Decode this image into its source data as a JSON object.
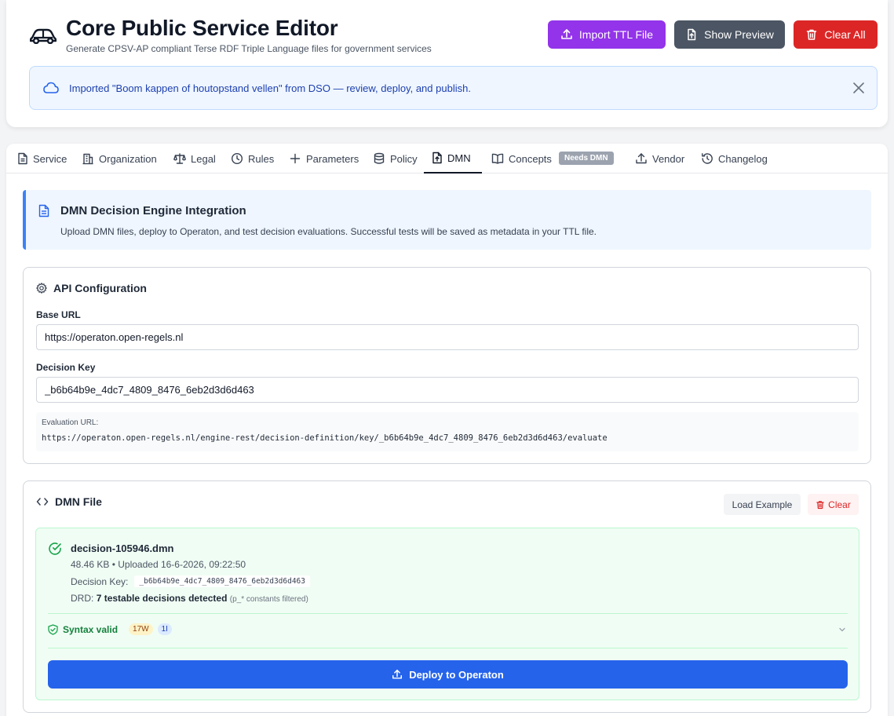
{
  "header": {
    "title": "Core Public Service Editor",
    "subtitle": "Generate CPSV-AP compliant Terse RDF Triple Language files for government services",
    "buttons": {
      "import": "Import TTL File",
      "preview": "Show Preview",
      "clear_all": "Clear All"
    },
    "colors": {
      "import": "#9333ea",
      "preview": "#4b5563",
      "clear_all": "#dc2626"
    }
  },
  "notice": {
    "text": "Imported \"Boom kappen of houtopstand vellen\" from DSO — review, deploy, and publish."
  },
  "tabs": [
    {
      "label": "Service",
      "icon": "document-icon"
    },
    {
      "label": "Organization",
      "icon": "building-icon"
    },
    {
      "label": "Legal",
      "icon": "scale-icon"
    },
    {
      "label": "Rules",
      "icon": "clock-icon"
    },
    {
      "label": "Parameters",
      "icon": "plus-icon"
    },
    {
      "label": "Policy",
      "icon": "database-icon"
    },
    {
      "label": "DMN",
      "icon": "file-upload-icon",
      "active": true
    },
    {
      "label": "Concepts",
      "icon": "book-icon",
      "badge": "Needs DMN"
    },
    {
      "label": "Vendor",
      "icon": "upload-icon"
    },
    {
      "label": "Changelog",
      "icon": "history-icon"
    }
  ],
  "dmn": {
    "info_title": "DMN Decision Engine Integration",
    "info_desc": "Upload DMN files, deploy to Operaton, and test decision evaluations. Successful tests will be saved as metadata in your TTL file.",
    "api": {
      "title": "API Configuration",
      "base_url_label": "Base URL",
      "base_url": "https://operaton.open-regels.nl",
      "decision_key_label": "Decision Key",
      "decision_key": "_b6b64b9e_4dc7_4809_8476_6eb2d3d6d463",
      "eval_label": "Evaluation URL:",
      "eval_url": "https://operaton.open-regels.nl/engine-rest/decision-definition/key/_b6b64b9e_4dc7_4809_8476_6eb2d3d6d463/evaluate"
    },
    "file": {
      "title": "DMN File",
      "load_example": "Load Example",
      "clear": "Clear",
      "name": "decision-105946.dmn",
      "meta": "48.46 KB • Uploaded 16-6-2026, 09:22:50",
      "key_label": "Decision Key:",
      "key": "_b6b64b9e_4dc7_4809_8476_6eb2d3d6d463",
      "drd_prefix": "DRD:",
      "drd_bold": "7 testable decisions detected",
      "drd_note": "(p_* constants filtered)",
      "syntax": "Syntax valid",
      "warnings": "17W",
      "infos": "1I",
      "deploy": "Deploy to Operaton",
      "deploy_color": "#2563eb"
    }
  }
}
